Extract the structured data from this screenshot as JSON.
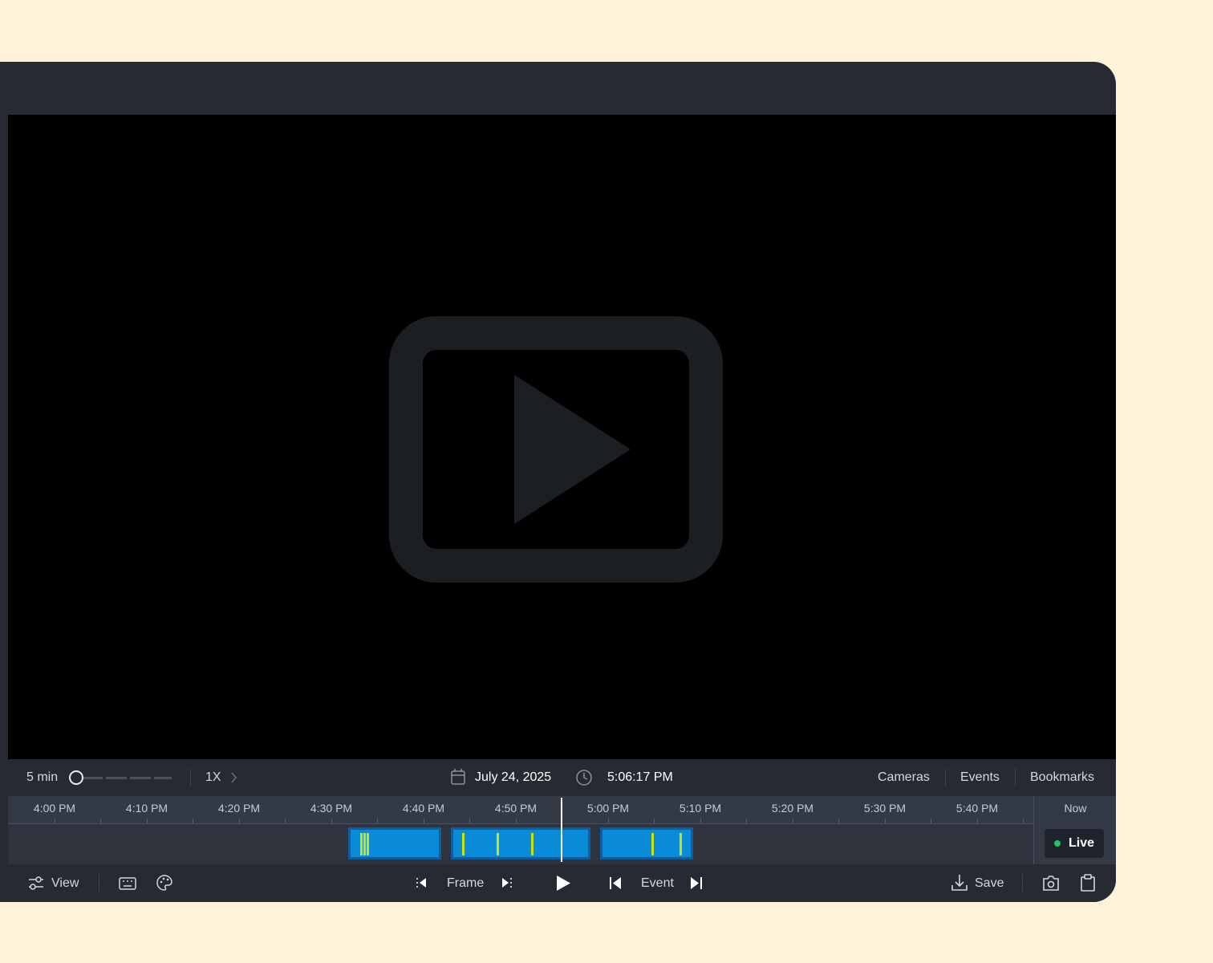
{
  "timeline": {
    "zoom_label": "5 min",
    "speed_label": "1X",
    "date": "July 24, 2025",
    "time": "5:06:17 PM",
    "tabs": [
      "Cameras",
      "Events",
      "Bookmarks"
    ],
    "ticks": [
      "4:00 PM",
      "4:10 PM",
      "4:20 PM",
      "4:30 PM",
      "4:40 PM",
      "4:50 PM",
      "5:00 PM",
      "5:10 PM",
      "5:20 PM",
      "5:30 PM",
      "5:40 PM"
    ],
    "now_label": "Now",
    "live_label": "Live"
  },
  "controls": {
    "view_label": "View",
    "frame_label": "Frame",
    "event_label": "Event",
    "save_label": "Save"
  },
  "colors": {
    "background": "#fff3dc",
    "panel": "#262a33",
    "recording": "#0a8bd8",
    "event_marker": "#c9e312",
    "live_dot": "#22c55e"
  }
}
